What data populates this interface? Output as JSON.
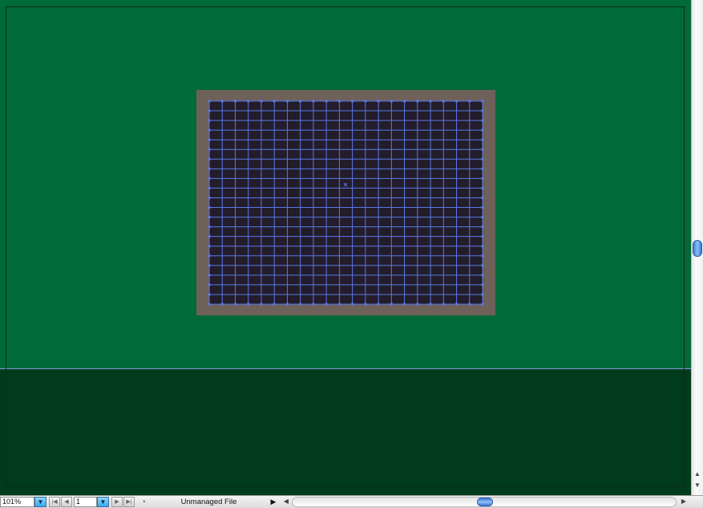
{
  "statusbar": {
    "zoom_value": "101%",
    "page_value": "1",
    "status_text": "Unmanaged File"
  },
  "icons": {
    "zoom_dropdown": "triangle-down",
    "page_dropdown": "triangle-down",
    "first_page": "first-page",
    "prev_page": "prev-page",
    "next_page": "next-page",
    "last_page": "last-page",
    "status_menu": "triangle-right"
  },
  "colors": {
    "pasteboard": "#006a38",
    "bleed": "#003c1c",
    "frame": "#6d615a",
    "grid_fill": "#231c2a",
    "grid_lines": "#5a78e6",
    "scroll_accent": "#3c78d8"
  }
}
